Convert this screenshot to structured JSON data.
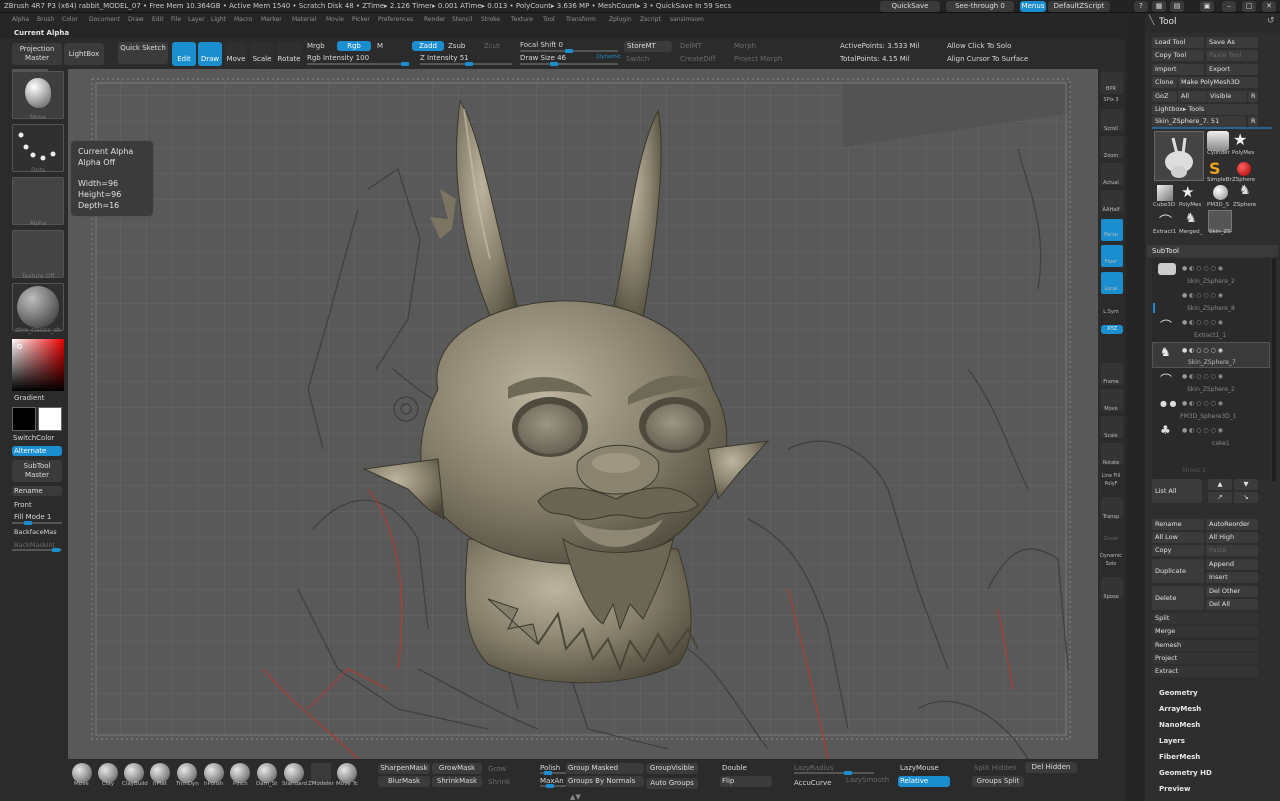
{
  "titlebar": {
    "info": "ZBrush 4R7 P3 (x64)   rabbit_MODEL_07   • Free Mem 10.364GB • Active Mem 1540 • Scratch Disk 48 • ZTime▸ 2.126 Timer▸ 0.001 ATime▸ 0.013 • PolyCount▸ 3.636 MP • MeshCount▸ 3 • QuickSave In 59 Secs",
    "quicksave": "QuickSave",
    "seethrough": "See-through  0",
    "menus": "Menus",
    "script": "DefaultZScript"
  },
  "menubar": [
    "Alpha",
    "Brush",
    "Color",
    "Document",
    "Draw",
    "Edit",
    "File",
    "Layer",
    "Light",
    "Macro",
    "Marker",
    "Material",
    "Movie",
    "Picker",
    "Preferences",
    "Render",
    "Stencil",
    "Stroke",
    "Texture",
    "Tool",
    "Transform",
    "Zplugin",
    "Zscript",
    "sansimsom"
  ],
  "current_alpha_title": "Current Alpha",
  "topshelf": {
    "projection_master": "Projection Master",
    "lightbox": "LightBox",
    "quick_sketch": "Quick Sketch",
    "edit": "Edit",
    "draw": "Draw",
    "move": "Move",
    "scale": "Scale",
    "rotate": "Rotate",
    "mrgb": "Mrgb",
    "rgb": "Rgb",
    "m": "M",
    "rgb_intensity": "Rgb Intensity 100",
    "zadd": "Zadd",
    "zsub": "Zsub",
    "zcut": "Zcut",
    "z_intensity": "Z Intensity 51",
    "focal_shift": "Focal Shift 0",
    "draw_size": "Draw Size 46",
    "dynamic": "Dynamic",
    "storemt": "StoreMT",
    "delmt": "DelMT",
    "morph": "Morph",
    "switch": "Switch",
    "creatediff": "CreateDiff",
    "project_morph": "Project Morph",
    "active_points": "ActivePoints: 3.533 Mil",
    "total_points": "TotalPoints: 4.15 Mil",
    "allow_click": "Allow Click To Solo",
    "align_cursor": "Align Cursor To Surface"
  },
  "leftshelf": {
    "brush_label": "Move",
    "stroke_label": "Dots",
    "alpha_label": "Alpha",
    "texture_label": "Texture Off",
    "material_label": "zbro_classic_sh",
    "gradient": "Gradient",
    "switchcolor": "SwitchColor",
    "alternate": "Alternate",
    "subtool_master": "SubTool Master",
    "rename": "Rename",
    "front": "Front",
    "fill_mode": "Fill Mode 1",
    "backface": "BackfaceMas",
    "backmaskint": "BackMaskInt"
  },
  "alpha_popup": {
    "title": "Current Alpha",
    "state": "Alpha Off",
    "width": "Width=96",
    "height": "Height=96",
    "depth": "Depth=16"
  },
  "rightshelf": [
    "BPR",
    "SPix 3",
    "Scroll",
    "Zoom",
    "Actual",
    "AAHalf",
    "Persp",
    "Floor",
    "Local",
    "L.Sym",
    "XYZ",
    "Frame",
    "Move",
    "Scale",
    "Rotate",
    "Line Fill PolyF",
    "Transp",
    "Ghost",
    "Dynamic Solo",
    "Xpose"
  ],
  "toolpanel": {
    "title": "Tool",
    "load_tool": "Load Tool",
    "save_as": "Save As",
    "copy_tool": "Copy Tool",
    "paste_tool": "Paste Tool",
    "import": "Import",
    "export": "Export",
    "clone": "Clone",
    "make_polymesh": "Make PolyMesh3D",
    "goz": "GoZ",
    "all": "All",
    "visible": "Visible",
    "r": "R",
    "lightbox_tools": "Lightbox▸ Tools",
    "current_tool": "Skin_ZSphere_7. 51",
    "tool_thumbs": [
      "Cylinder",
      "PolyMes",
      "SimpleBr",
      "ZSphere",
      "Cube3D",
      "PolyMes",
      "PM3D_S",
      "ZSphere",
      "Extract1",
      "Merged_",
      "Skin_ZS"
    ],
    "subtool_head": "SubTool",
    "subtools": [
      "Skin_ZSphere_2",
      "Skin_ZSphere_8",
      "Extract1_1",
      "Skin_ZSphere_7",
      "Skin_ZSphere_2",
      "PM3D_Sphere3D_1",
      "cake1",
      "Shoes 1"
    ],
    "list_all": "List All",
    "rename": "Rename",
    "autoreorder": "AutoReorder",
    "all_low": "All Low",
    "all_high": "All High",
    "copy": "Copy",
    "paste": "Paste",
    "duplicate": "Duplicate",
    "append": "Append",
    "insert": "Insert",
    "delete": "Delete",
    "del_other": "Del Other",
    "del_all": "Del All",
    "sections": [
      "Split",
      "Merge",
      "Remesh",
      "Project",
      "Extract"
    ],
    "menus": [
      "Geometry",
      "ArrayMesh",
      "NanoMesh",
      "Layers",
      "FiberMesh",
      "Geometry HD",
      "Preview"
    ]
  },
  "bottomshelf": {
    "brushes": [
      "Move",
      "Clay",
      "ClayBuild",
      "hPlat",
      "TrimDyn",
      "hPolish",
      "Pinch",
      "Dam_St",
      "Standard",
      "ZModeler",
      "Move Tc"
    ],
    "sharpenmask": "SharpenMask",
    "growmask": "GrowMask",
    "grow": "Grow",
    "blurmask": "BlurMask",
    "shrinkmask": "ShrinkMask",
    "shrink": "Shrink",
    "polish": "Polish",
    "maxangle": "MaxAn",
    "group_masked": "Group Masked",
    "groups_by_normals": "Groups By Normals",
    "groupvisible": "GroupVisible",
    "auto_groups": "Auto Groups",
    "double": "Double",
    "flip": "Flip",
    "lazyradius": "LazyRadius",
    "accucurve": "AccuCurve",
    "lazysmooth": "LazySmooth",
    "lazymouse": "LazyMouse",
    "relative": "Relative",
    "split_hidden": "Split Hidden",
    "del_hidden": "Del Hidden",
    "groups_split": "Groups Split"
  }
}
